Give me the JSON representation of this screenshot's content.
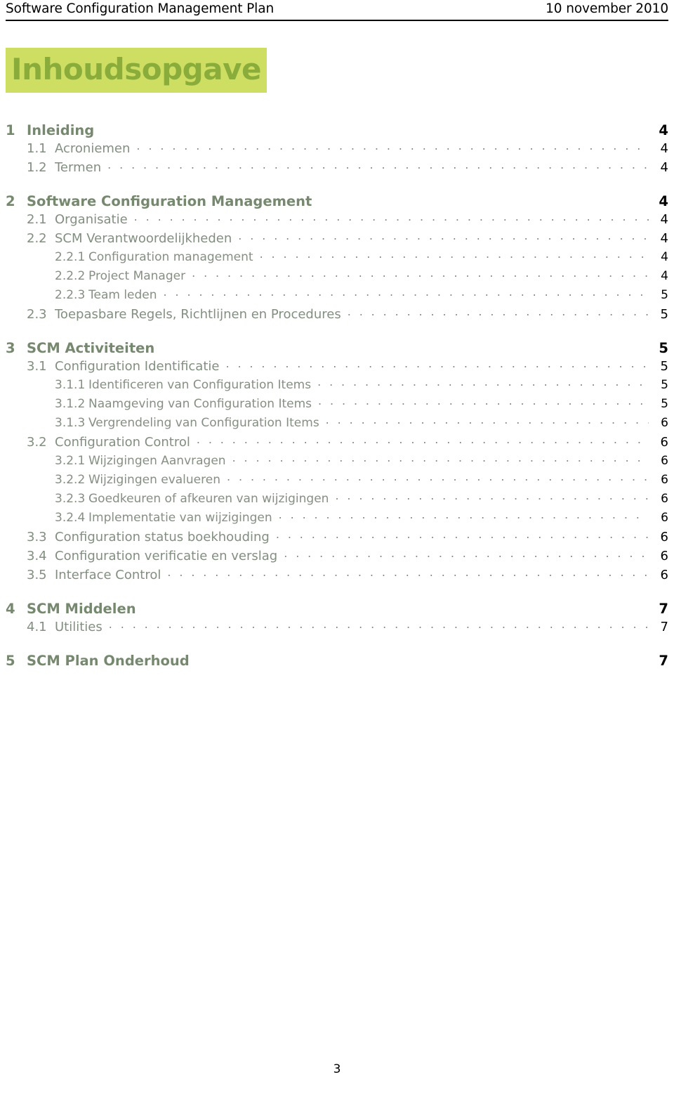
{
  "header": {
    "document_title": "Software Configuration Management Plan",
    "date": "10 november 2010"
  },
  "title": "Inhoudsopgave",
  "footer": {
    "page_number": "3"
  },
  "colors": {
    "title_background": "#cede63",
    "title_text": "#8aac3a",
    "chapter_text": "#76896f",
    "section_text": "#828f80",
    "leader_dots": "#7f8c7c",
    "rule": "#000000"
  },
  "toc": {
    "entries": [
      {
        "level": 1,
        "number": "1",
        "label": "Inleiding",
        "page": "4",
        "gap_before": false
      },
      {
        "level": 2,
        "number": "1.1",
        "label": "Acroniemen",
        "page": "4",
        "gap_before": false
      },
      {
        "level": 2,
        "number": "1.2",
        "label": "Termen",
        "page": "4",
        "gap_before": false
      },
      {
        "level": 1,
        "number": "2",
        "label": "Software Configuration Management",
        "page": "4",
        "gap_before": true
      },
      {
        "level": 2,
        "number": "2.1",
        "label": "Organisatie",
        "page": "4",
        "gap_before": false
      },
      {
        "level": 2,
        "number": "2.2",
        "label": "SCM Verantwoordelijkheden",
        "page": "4",
        "gap_before": false
      },
      {
        "level": 3,
        "number": "2.2.1",
        "label": "Configuration management",
        "page": "4",
        "gap_before": false
      },
      {
        "level": 3,
        "number": "2.2.2",
        "label": "Project Manager",
        "page": "4",
        "gap_before": false
      },
      {
        "level": 3,
        "number": "2.2.3",
        "label": "Team leden",
        "page": "5",
        "gap_before": false
      },
      {
        "level": 2,
        "number": "2.3",
        "label": "Toepasbare Regels, Richtlijnen en Procedures",
        "page": "5",
        "gap_before": false
      },
      {
        "level": 1,
        "number": "3",
        "label": "SCM Activiteiten",
        "page": "5",
        "gap_before": true
      },
      {
        "level": 2,
        "number": "3.1",
        "label": "Configuration Identificatie",
        "page": "5",
        "gap_before": false
      },
      {
        "level": 3,
        "number": "3.1.1",
        "label": "Identificeren van Configuration Items",
        "page": "5",
        "gap_before": false
      },
      {
        "level": 3,
        "number": "3.1.2",
        "label": "Naamgeving van Configuration Items",
        "page": "5",
        "gap_before": false
      },
      {
        "level": 3,
        "number": "3.1.3",
        "label": "Vergrendeling van Configuration Items",
        "page": "6",
        "gap_before": false
      },
      {
        "level": 2,
        "number": "3.2",
        "label": "Configuration Control",
        "page": "6",
        "gap_before": false
      },
      {
        "level": 3,
        "number": "3.2.1",
        "label": "Wijzigingen Aanvragen",
        "page": "6",
        "gap_before": false
      },
      {
        "level": 3,
        "number": "3.2.2",
        "label": "Wijzigingen evalueren",
        "page": "6",
        "gap_before": false
      },
      {
        "level": 3,
        "number": "3.2.3",
        "label": "Goedkeuren of afkeuren van wijzigingen",
        "page": "6",
        "gap_before": false
      },
      {
        "level": 3,
        "number": "3.2.4",
        "label": "Implementatie van wijzigingen",
        "page": "6",
        "gap_before": false
      },
      {
        "level": 2,
        "number": "3.3",
        "label": "Configuration status boekhouding",
        "page": "6",
        "gap_before": false
      },
      {
        "level": 2,
        "number": "3.4",
        "label": "Configuration verificatie en verslag",
        "page": "6",
        "gap_before": false
      },
      {
        "level": 2,
        "number": "3.5",
        "label": "Interface Control",
        "page": "6",
        "gap_before": false
      },
      {
        "level": 1,
        "number": "4",
        "label": "SCM Middelen",
        "page": "7",
        "gap_before": true
      },
      {
        "level": 2,
        "number": "4.1",
        "label": "Utilities",
        "page": "7",
        "gap_before": false
      },
      {
        "level": 1,
        "number": "5",
        "label": "SCM Plan Onderhoud",
        "page": "7",
        "gap_before": true
      }
    ]
  }
}
